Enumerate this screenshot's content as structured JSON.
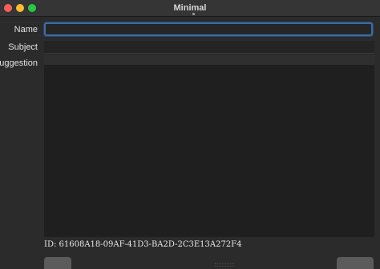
{
  "window": {
    "title": "Minimal"
  },
  "form": {
    "name_label": "Name",
    "subject_label": "Subject",
    "suggestion_label": "Suggestion",
    "name_value": "",
    "subject_value": "",
    "suggestion_value": ""
  },
  "footer": {
    "id_text": "ID: 61608A18-09AF-41D3-BA2D-2C3E13A272F4"
  },
  "colors": {
    "close": "#ff5f57",
    "minimize": "#febc2e",
    "maximize": "#28c840",
    "focus_ring": "#3d6da3"
  }
}
